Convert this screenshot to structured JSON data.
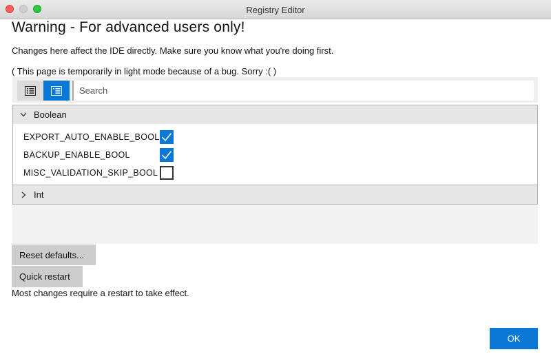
{
  "window": {
    "title": "Registry Editor"
  },
  "heading": "Warning - For advanced users only!",
  "description": "Changes here affect the IDE directly. Make sure you know what you're doing first.",
  "note": "( This page is temporarily in light mode because of a bug. Sorry :(  )",
  "toolbar": {
    "search_placeholder": "Search",
    "list_view_icon": "list-icon",
    "detail_view_icon": "detail-list-icon",
    "active_view": "detail"
  },
  "groups": [
    {
      "label": "Boolean",
      "expanded": true,
      "items": [
        {
          "key": "EXPORT_AUTO_ENABLE_BOOL",
          "checked": true
        },
        {
          "key": "BACKUP_ENABLE_BOOL",
          "checked": true
        },
        {
          "key": "MISC_VALIDATION_SKIP_BOOL",
          "checked": false
        }
      ]
    },
    {
      "label": "Int",
      "expanded": false
    }
  ],
  "buttons": {
    "reset": "Reset defaults...",
    "restart": "Quick restart",
    "ok": "OK"
  },
  "restart_hint": "Most changes require a restart to take effect.",
  "colors": {
    "accent": "#0a78d7",
    "button_gray": "#cdcdcd",
    "group_header": "#e6e6e6"
  }
}
